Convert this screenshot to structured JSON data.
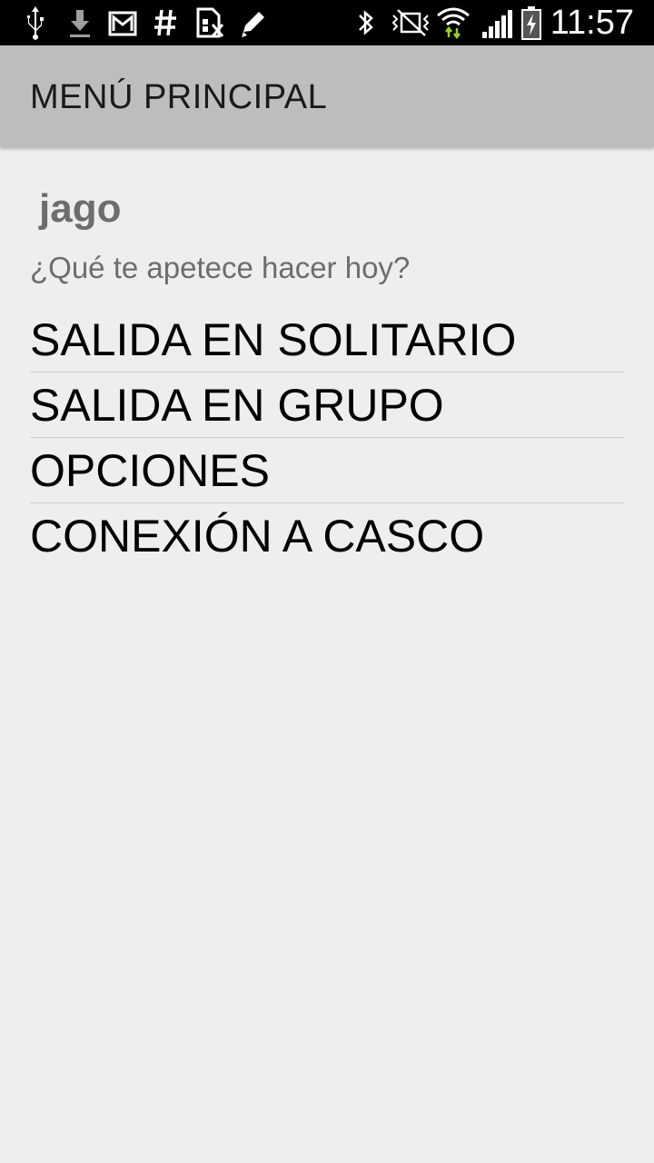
{
  "status_bar": {
    "time": "11:57",
    "left_icons": [
      "usb-icon",
      "download-icon",
      "gmail-icon",
      "hashtag-icon",
      "sim-card-icon",
      "pencil-icon"
    ],
    "right_icons": [
      "bluetooth-icon",
      "nfc-icon",
      "wifi-icon",
      "signal-icon",
      "battery-charging-icon"
    ],
    "wifi_accent": "#9acd32"
  },
  "action_bar": {
    "title": "MENÚ PRINCIPAL"
  },
  "main": {
    "username": "jago",
    "subtitle": "¿Qué te apetece hacer hoy?",
    "menu_items": [
      {
        "label": "SALIDA EN SOLITARIO"
      },
      {
        "label": "SALIDA EN GRUPO"
      },
      {
        "label": "OPCIONES"
      },
      {
        "label": "CONEXIÓN A CASCO"
      }
    ]
  },
  "colors": {
    "background": "#eeeeee",
    "action_bar": "#bdbdbd",
    "status_bar": "#000000",
    "secondary_text": "#6d6d6d"
  }
}
